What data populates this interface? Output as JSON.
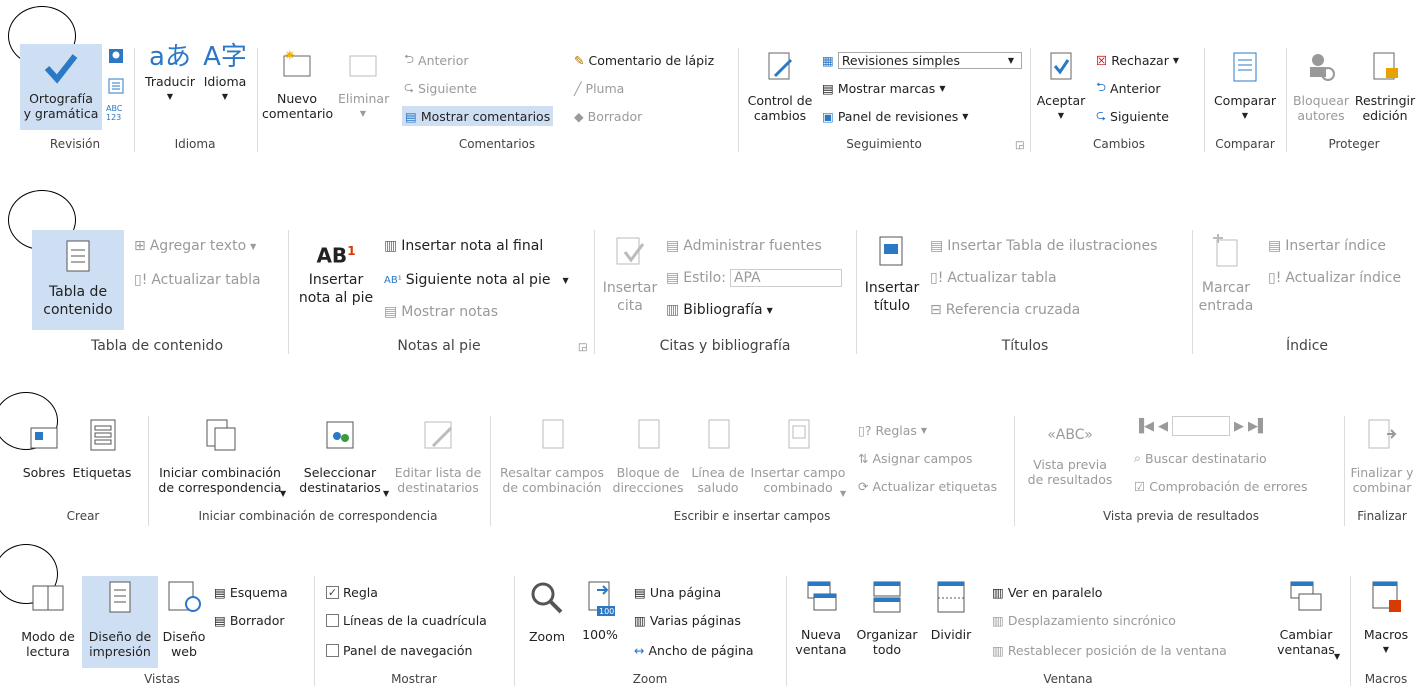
{
  "revisar": {
    "revision": {
      "label": "Revisión",
      "ortografia": "Ortografía\ny gramática"
    },
    "idioma": {
      "label": "Idioma",
      "traducir": "Traducir",
      "idioma": "Idioma"
    },
    "comentarios": {
      "label": "Comentarios",
      "nuevo": "Nuevo\ncomentario",
      "eliminar": "Eliminar",
      "anterior": "Anterior",
      "siguiente": "Siguiente",
      "mostrar": "Mostrar comentarios",
      "lapiz": "Comentario de lápiz",
      "pluma": "Pluma",
      "borrador": "Borrador"
    },
    "seguimiento": {
      "label": "Seguimiento",
      "control": "Control de\ncambios",
      "revisiones": "Revisiones simples",
      "marcas": "Mostrar marcas",
      "panel": "Panel de revisiones"
    },
    "cambios": {
      "label": "Cambios",
      "aceptar": "Aceptar",
      "rechazar": "Rechazar",
      "anterior": "Anterior",
      "siguiente": "Siguiente"
    },
    "comparar": {
      "label": "Comparar",
      "comparar": "Comparar"
    },
    "proteger": {
      "label": "Proteger",
      "bloquear": "Bloquear\nautores",
      "restringir": "Restringir\nedición"
    }
  },
  "referencias": {
    "tabla": {
      "label": "Tabla de contenido",
      "tabla": "Tabla de\ncontenido",
      "agregar": "Agregar texto",
      "actualizar": "Actualizar tabla"
    },
    "notas": {
      "label": "Notas al pie",
      "insertar": "Insertar\nnota al pie",
      "final": "Insertar nota al final",
      "siguiente": "Siguiente nota al pie",
      "mostrar": "Mostrar notas",
      "ab": "AB",
      "sup": "1"
    },
    "citas": {
      "label": "Citas y bibliografía",
      "insertar": "Insertar\ncita",
      "fuentes": "Administrar fuentes",
      "estilo": "Estilo:",
      "estilo_val": "APA",
      "bibliografia": "Bibliografía"
    },
    "titulos": {
      "label": "Títulos",
      "insertar": "Insertar\ntítulo",
      "tabla_ilus": "Insertar Tabla de ilustraciones",
      "actualizar": "Actualizar tabla",
      "referencia": "Referencia cruzada"
    },
    "indice": {
      "label": "Índice",
      "marcar": "Marcar\nentrada",
      "insertar": "Insertar índice",
      "actualizar": "Actualizar índice"
    }
  },
  "correspondencia": {
    "crear": {
      "label": "Crear",
      "sobres": "Sobres",
      "etiquetas": "Etiquetas"
    },
    "iniciar": {
      "label": "Iniciar combinación de correspondencia",
      "iniciar": "Iniciar combinación\nde correspondencia",
      "seleccionar": "Seleccionar\ndestinatarios",
      "editar": "Editar lista de\ndestinatarios"
    },
    "escribir": {
      "label": "Escribir e insertar campos",
      "resaltar": "Resaltar campos\nde combinación",
      "bloque": "Bloque de\ndirecciones",
      "linea": "Línea de\nsaludo",
      "insertar": "Insertar campo\ncombinado",
      "reglas": "Reglas",
      "asignar": "Asignar campos",
      "actualizar": "Actualizar etiquetas"
    },
    "vista": {
      "label": "Vista previa de resultados",
      "vista": "Vista previa\nde resultados",
      "buscar": "Buscar destinatario",
      "comprobacion": "Comprobación de errores"
    },
    "finalizar": {
      "label": "Finalizar",
      "finalizar": "Finalizar y\ncombinar"
    }
  },
  "vista": {
    "vistas": {
      "label": "Vistas",
      "lectura": "Modo de\nlectura",
      "impresion": "Diseño de\nimpresión",
      "web": "Diseño\nweb",
      "esquema": "Esquema",
      "borrador": "Borrador"
    },
    "mostrar": {
      "label": "Mostrar",
      "regla": "Regla",
      "lineas": "Líneas de la cuadrícula",
      "panel": "Panel de navegación",
      "regla_checked": true
    },
    "zoom": {
      "label": "Zoom",
      "zoom": "Zoom",
      "cien": "100%",
      "cien_icon": "100",
      "una": "Una página",
      "varias": "Varias páginas",
      "ancho": "Ancho de página"
    },
    "ventana": {
      "label": "Ventana",
      "nueva": "Nueva\nventana",
      "organizar": "Organizar\ntodo",
      "dividir": "Dividir",
      "paralelo": "Ver en paralelo",
      "desplazamiento": "Desplazamiento sincrónico",
      "restablecer": "Restablecer posición de la ventana",
      "cambiar": "Cambiar\nventanas"
    },
    "macros": {
      "label": "Macros",
      "macros": "Macros"
    }
  },
  "colors": {
    "accent": "#2b78c5",
    "selected": "#cfdff3",
    "disabled": "#9a9a9a",
    "red": "#d83b01"
  }
}
